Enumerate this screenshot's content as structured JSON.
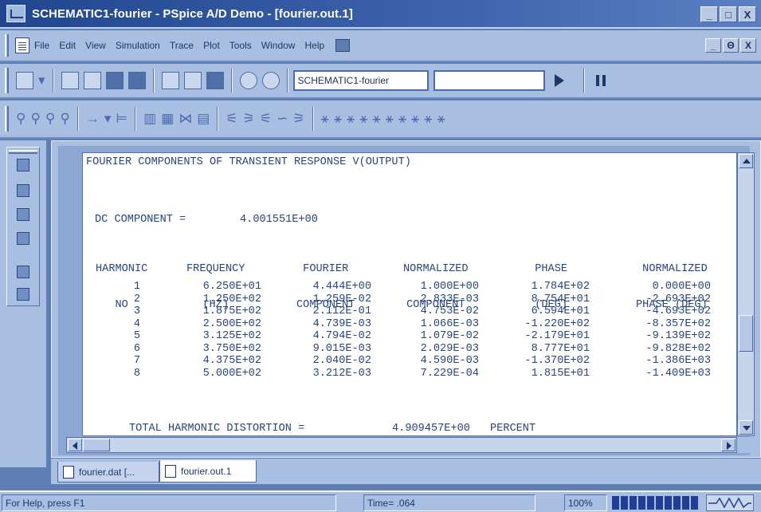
{
  "window": {
    "title": "SCHEMATIC1-fourier - PSpice A/D Demo - [fourier.out.1]",
    "controls": [
      "_",
      "□",
      "X"
    ],
    "doc_controls": [
      "_",
      "Θ",
      "X"
    ]
  },
  "menu": [
    "File",
    "Edit",
    "View",
    "Simulation",
    "Trace",
    "Plot",
    "Tools",
    "Window",
    "Help"
  ],
  "toolbar": {
    "profile_combo": "SCHEMATIC1-fourier",
    "second_combo": ""
  },
  "output": {
    "heading": "FOURIER COMPONENTS OF TRANSIENT RESPONSE V(OUTPUT)",
    "dc_label": "DC COMPONENT =",
    "dc_value": "4.001551E+00",
    "columns": [
      {
        "line1": "HARMONIC",
        "line2": "NO"
      },
      {
        "line1": "FREQUENCY",
        "line2": "(HZ)"
      },
      {
        "line1": "FOURIER",
        "line2": "COMPONENT"
      },
      {
        "line1": "NORMALIZED",
        "line2": "COMPONENT"
      },
      {
        "line1": "PHASE",
        "line2": "(DEG)"
      },
      {
        "line1": "NORMALIZED",
        "line2": "PHASE (DEG)"
      }
    ],
    "rows": [
      [
        "1",
        "6.250E+01",
        "4.444E+00",
        "1.000E+00",
        "1.784E+02",
        "0.000E+00"
      ],
      [
        "2",
        "1.250E+02",
        "1.259E-02",
        "2.833E-03",
        "8.754E+01",
        "-2.693E+02"
      ],
      [
        "3",
        "1.875E+02",
        "2.112E-01",
        "4.753E-02",
        "6.594E+01",
        "-4.693E+02"
      ],
      [
        "4",
        "2.500E+02",
        "4.739E-03",
        "1.066E-03",
        "-1.220E+02",
        "-8.357E+02"
      ],
      [
        "5",
        "3.125E+02",
        "4.794E-02",
        "1.079E-02",
        "-2.179E+01",
        "-9.139E+02"
      ],
      [
        "6",
        "3.750E+02",
        "9.015E-03",
        "2.029E-03",
        "8.777E+01",
        "-9.828E+02"
      ],
      [
        "7",
        "4.375E+02",
        "2.040E-02",
        "4.590E-03",
        "-1.370E+02",
        "-1.386E+03"
      ],
      [
        "8",
        "5.000E+02",
        "3.212E-03",
        "7.229E-04",
        "1.815E+01",
        "-1.409E+03"
      ]
    ],
    "thd_label": "TOTAL HARMONIC DISTORTION =",
    "thd_value": "4.909457E+00",
    "thd_unit": "PERCENT"
  },
  "tabs": [
    {
      "label": "fourier.dat [...",
      "active": false
    },
    {
      "label": "fourier.out.1",
      "active": true
    }
  ],
  "status": {
    "help": "For Help, press F1",
    "time": "Time= .064",
    "zoom": "100%",
    "progress_fraction": 1.0
  },
  "colors": {
    "text": "#27457e",
    "titlebar": "#21468f",
    "chrome": "#a9bfe1",
    "progress": "#1f3f96"
  }
}
